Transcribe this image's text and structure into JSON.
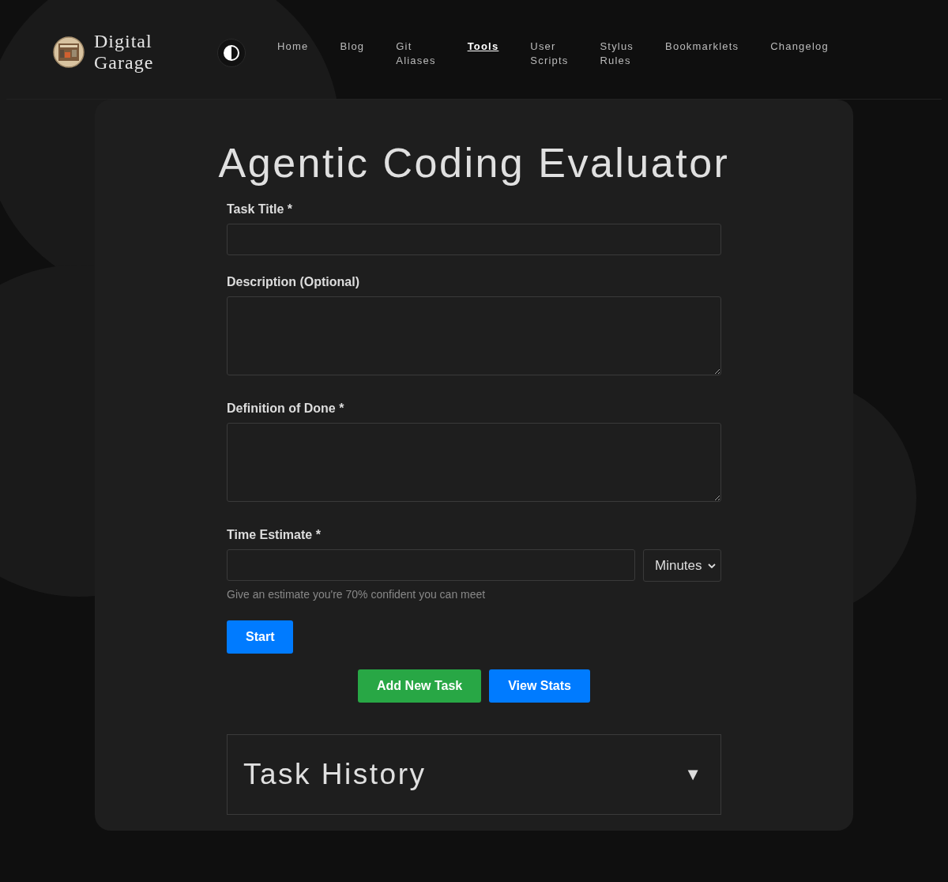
{
  "site": {
    "title": "Digital Garage"
  },
  "nav": [
    {
      "label": "Home",
      "selected": false
    },
    {
      "label": "Blog",
      "selected": false
    },
    {
      "label": "Git Aliases",
      "selected": false
    },
    {
      "label": "Tools",
      "selected": true
    },
    {
      "label": "User Scripts",
      "selected": false
    },
    {
      "label": "Stylus Rules",
      "selected": false
    },
    {
      "label": "Bookmarklets",
      "selected": false
    },
    {
      "label": "Changelog",
      "selected": false
    }
  ],
  "page_title": "Agentic Coding Evaluator",
  "fields": [
    {
      "kind": "input",
      "label": "Task Title *"
    },
    {
      "kind": "textarea",
      "label": "Description (Optional)"
    },
    {
      "kind": "textarea",
      "label": "Definition of Done *"
    },
    {
      "kind": "input-select",
      "label": "Time Estimate *",
      "select_value": "Minutes",
      "hint": "Give an estimate you're 70% confident you can meet"
    }
  ],
  "start_button": {
    "label": "Start",
    "color": "#007bff"
  },
  "actions": [
    {
      "label": "Add New Task",
      "color": "#28a745"
    },
    {
      "label": "View Stats",
      "color": "#007bff"
    }
  ],
  "task_history": {
    "title": "Task History",
    "toggle": "▼"
  }
}
